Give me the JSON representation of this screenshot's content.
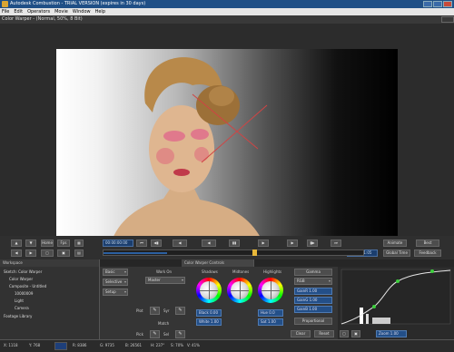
{
  "app": {
    "title": "Autodesk Combustion - TRIAL VERSION (expires in 30 days)"
  },
  "menu": [
    "File",
    "Edit",
    "Operators",
    "Movie",
    "Window",
    "Help"
  ],
  "viewer": {
    "label": "Color Warper - (Normal, 50%, 8 Bit)"
  },
  "transport": {
    "home_label": "Home",
    "fps_label": "Fps",
    "timecode_start": "00:00:00:00",
    "timecode_end": "00:00:01:05",
    "animate_label": "Animate",
    "best_label": "Best",
    "global_time_label": "Global Time",
    "feedback_label": "Feedback",
    "frame_progress": 0.58
  },
  "tabs": {
    "workspace": "Workspace",
    "operator": "Color Warper Controls"
  },
  "workspace": {
    "items": [
      "Sketch: Color Warper",
      "Color Warper",
      "Composite - Untitled",
      "10000009",
      "Light",
      "Camera",
      "Footage Library"
    ]
  },
  "controls": {
    "basic_label": "Basic",
    "selective_label": "Selective",
    "setup_label": "Setup",
    "work_on_label": "Work On",
    "work_on_value": "Master",
    "shadows_label": "Shadows",
    "midtones_label": "Midtones",
    "highlights_label": "Highlights",
    "gamma_label": "Gamma",
    "rgb_label": "RGB",
    "plot_label": "Plot",
    "match_label": "Match",
    "pick_label": "Pick",
    "syr_label": "Syr",
    "sel_label": "Sel",
    "black_value": "Black 0.00",
    "white_value": "White 1.00",
    "hue_value": "Hue 0.0",
    "sat_value": "Sat 1.00",
    "gain_r": "GainR 1.00",
    "gain_g": "GainG 1.00",
    "gain_b": "GainB 1.00",
    "proportional_label": "Proportional",
    "clear_label": "Clear",
    "reset_label": "Reset",
    "zoom_label": "Zoom 1.00"
  },
  "status": {
    "x": "X: 1118",
    "y": "Y: 768",
    "r": "R: 8386",
    "g": "G: 9735",
    "b": "B: 26561",
    "h": "H: 237°",
    "s": "S: 70%",
    "v": "V: 41%",
    "swatch_color": "#1e3f7a"
  },
  "colors": {
    "accent": "#1f4f86",
    "value_field": "#234f88"
  }
}
